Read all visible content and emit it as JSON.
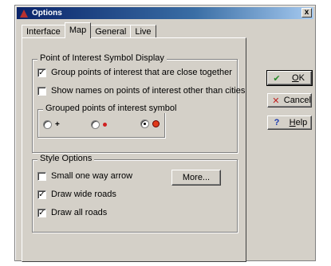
{
  "window": {
    "title": "Options",
    "close_glyph": "x"
  },
  "tabs": [
    {
      "label": "Interface"
    },
    {
      "label": "Map"
    },
    {
      "label": "General"
    },
    {
      "label": "Live"
    }
  ],
  "poi_group": {
    "title": "Point of Interest Symbol Display",
    "group_close": {
      "label": "Group points of interest that are close together",
      "checked": true
    },
    "show_names": {
      "label": "Show names on points of interest other than cities",
      "checked": false
    },
    "symbol_group": {
      "title": "Grouped points of interest symbol",
      "options": [
        {
          "symbol": "plus",
          "selected": false
        },
        {
          "symbol": "small-red-dot",
          "selected": false
        },
        {
          "symbol": "large-red-dot",
          "selected": true
        }
      ]
    }
  },
  "style_group": {
    "title": "Style Options",
    "small_arrow": {
      "label": "Small one way arrow",
      "checked": false
    },
    "wide_roads": {
      "label": "Draw wide roads",
      "checked": true
    },
    "all_roads": {
      "label": "Draw all roads",
      "checked": true
    },
    "more_button": "More..."
  },
  "buttons": {
    "ok": {
      "label": "OK",
      "icon": "checkmark-icon",
      "icon_color": "#2a8a2a"
    },
    "cancel": {
      "label": "Cancel",
      "icon": "x-icon",
      "icon_color": "#c02020"
    },
    "help": {
      "label": "Help",
      "icon": "question-icon",
      "icon_color": "#1a3ab0"
    }
  },
  "check_glyph": "✓",
  "colors": {
    "face": "#d4d0c8",
    "title_start": "#0a246a",
    "title_end": "#a6caf0"
  }
}
